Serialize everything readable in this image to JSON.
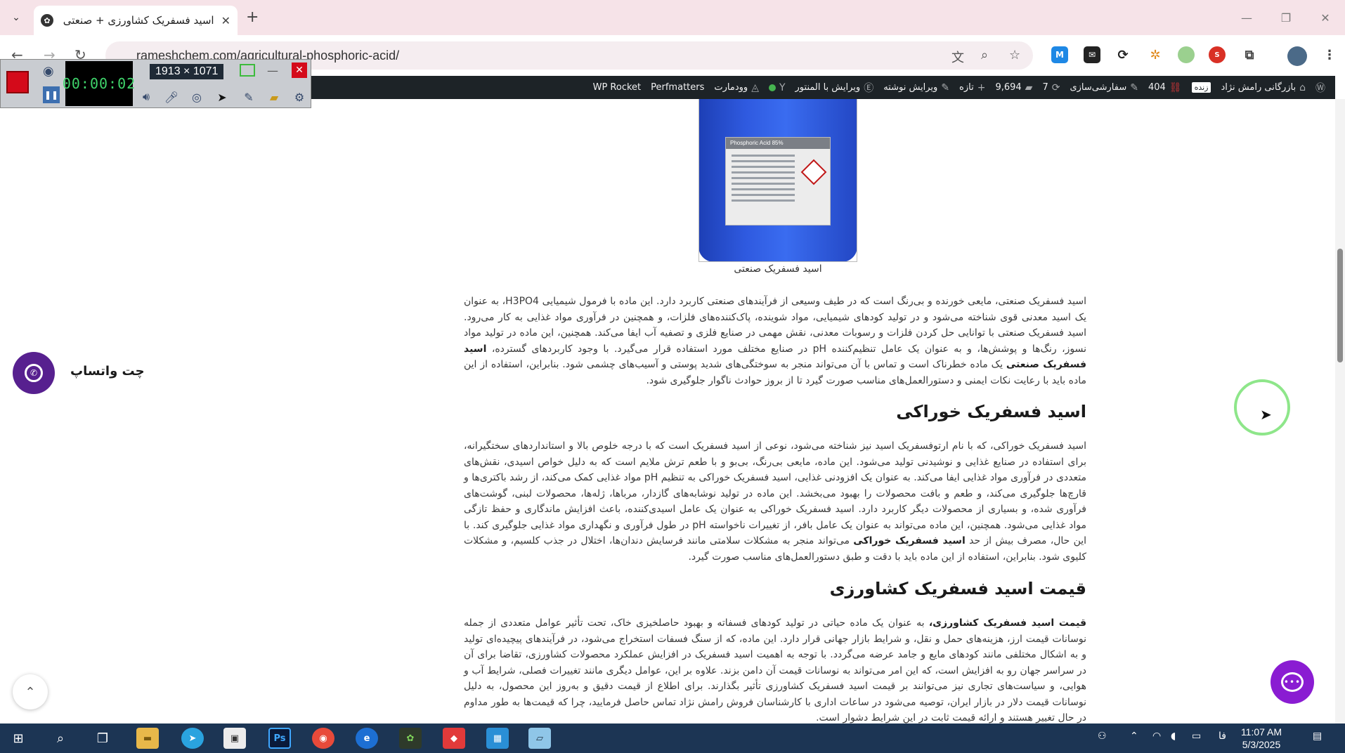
{
  "browser": {
    "tab_title": "اسید فسفریک کشاورزی + صنعتی",
    "url": "rameshchem.com/agricultural-phosphoric-acid/"
  },
  "recorder": {
    "timer": "00:00:02",
    "dimensions": "1913 × 1071"
  },
  "admin_bar": {
    "items": [
      {
        "label": "بازرگانی رامش نژاد"
      },
      {
        "label": "زنده"
      },
      {
        "label": "404"
      },
      {
        "label": "سفارشی‌سازی"
      },
      {
        "label": "7"
      },
      {
        "label": "9,694"
      },
      {
        "label": "تازه"
      },
      {
        "label": "ویرایش نوشته"
      },
      {
        "label": "ویرایش با المنتور"
      },
      {
        "label": "وودمارت"
      },
      {
        "label": "Perfmatters"
      },
      {
        "label": "WP Rocket"
      }
    ]
  },
  "product_image": {
    "label_text": "Phosphoric Acid 85%"
  },
  "content": {
    "caption": "اسید فسفریک صنعتی",
    "para1_plain": "اسید فسفریک صنعتی، مایعی خورنده و بی‌رنگ است که در طیف وسیعی از فرآیندهای صنعتی کاربرد دارد. این ماده با فرمول شیمیایی H3PO4، به عنوان یک اسید معدنی قوی شناخته می‌شود و در تولید کودهای شیمیایی، مواد شوینده، پاک‌کننده‌های فلزات، و همچنین در فرآوری مواد غذایی به کار می‌رود. اسید فسفریک صنعتی با توانایی حل کردن فلزات و رسوبات معدنی، نقش مهمی در صنایع فلزی و تصفیه آب ایفا می‌کند. همچنین، این ماده در تولید مواد نسوز، رنگ‌ها و پوشش‌ها، و به عنوان یک عامل تنظیم‌کننده pH در صنایع مختلف مورد استفاده قرار می‌گیرد. با وجود کاربردهای گسترده،",
    "para1_bold": "اسید فسفریک صنعتی",
    "para1_rest": "یک ماده خطرناک است و تماس با آن می‌تواند منجر به سوختگی‌های شدید پوستی و آسیب‌های چشمی شود. بنابراین، استفاده از این ماده باید با رعایت نکات ایمنی و دستورالعمل‌های مناسب صورت گیرد تا از بروز حوادث ناگوار جلوگیری شود.",
    "heading_food": "اسید فسفریک خوراکی",
    "para2_plain": "اسید فسفریک خوراکی، که با نام ارتوفسفریک اسید نیز شناخته می‌شود، نوعی از اسید فسفریک است که با درجه خلوص بالا و استانداردهای سختگیرانه، برای استفاده در صنایع غذایی و نوشیدنی تولید می‌شود. این ماده، مایعی بی‌رنگ، بی‌بو و با طعم ترش ملایم است که به دلیل خواص اسیدی، نقش‌های متعددی در فرآوری مواد غذایی ایفا می‌کند. به عنوان یک افزودنی غذایی، اسید فسفریک خوراکی به تنظیم pH مواد غذایی کمک می‌کند، از رشد باکتری‌ها و قارچ‌ها جلوگیری می‌کند، و طعم و بافت محصولات را بهبود می‌بخشد. این ماده در تولید نوشابه‌های گازدار، مرباها، ژله‌ها، محصولات لبنی، گوشت‌های فرآوری شده، و بسیاری از محصولات دیگر کاربرد دارد. اسید فسفریک خوراکی به عنوان یک عامل اسیدی‌کننده، باعث افزایش ماندگاری و حفظ تازگی مواد غذایی می‌شود. همچنین، این ماده می‌تواند به عنوان یک عامل بافر، از تغییرات ناخواسته pH در طول فرآوری و نگهداری مواد غذایی جلوگیری کند. با این حال، مصرف بیش از حد",
    "para2_bold": "اسید فسفریک خوراکی",
    "para2_rest": "می‌تواند منجر به مشکلات سلامتی مانند فرسایش دندان‌ها، اختلال در جذب کلسیم، و مشکلات کلیوی شود. بنابراین، استفاده از این ماده باید با دقت و طبق دستورالعمل‌های مناسب صورت گیرد.",
    "heading_price": "قیمت اسید فسفریک کشاورزی",
    "para3_bold": "قیمت اسید فسفریک کشاورزی،",
    "para3_plain": "به عنوان یک ماده حیاتی در تولید کودهای فسفاته و بهبود حاصلخیزی خاک، تحت تأثیر عوامل متعددی از جمله نوسانات قیمت ارز، هزینه‌های حمل و نقل، و شرایط بازار جهانی قرار دارد. این ماده، که از سنگ فسفات استخراج می‌شود، در فرآیندهای پیچیده‌ای تولید و به اشکال مختلفی مانند کودهای مایع و جامد عرضه می‌گردد. با توجه به اهمیت اسید فسفریک در افزایش عملکرد محصولات کشاورزی، تقاضا برای آن در سراسر جهان رو به افزایش است، که این امر می‌تواند به نوسانات قیمت آن دامن بزند. علاوه بر این، عوامل دیگری مانند تغییرات فصلی، شرایط آب و هوایی، و سیاست‌های تجاری نیز می‌توانند بر قیمت اسید فسفریک کشاورزی تأثیر بگذارند. برای اطلاع از قیمت دقیق و به‌روز این محصول، به دلیل نوسانات قیمت دلار در بازار ایران، توصیه می‌شود در ساعات اداری با کارشناسان فروش رامش نژاد تماس حاصل فرمایید، چرا که قیمت‌ها به طور مداوم در حال تغییر هستند و ارائه قیمت ثابت در این شرایط دشوار است."
  },
  "widgets": {
    "whatsapp_label": "چت واتساپ"
  },
  "taskbar": {
    "time": "11:07 AM",
    "date": "5/3/2025",
    "lang": "فا"
  }
}
